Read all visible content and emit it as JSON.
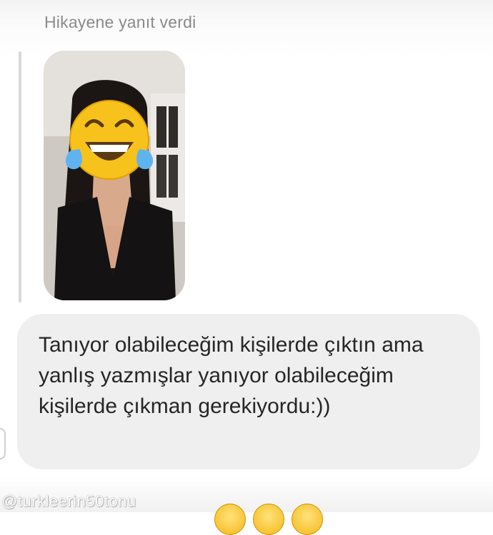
{
  "story_reply": {
    "header": "Hikayene yanıt verdi"
  },
  "story_preview": {
    "cover_emoji_icon": "tears-of-joy-emoji-icon"
  },
  "message": {
    "text": "Tanıyor olabileceğim kişilerde çıktın ama yanlış yazmışlar yanıyor olabileceğim kişilerde çıkman gerekiyordu:))"
  },
  "watermark": {
    "text": "@turkleerin50tonu"
  },
  "bottom_emojis": [
    "emoji-icon",
    "emoji-icon",
    "emoji-icon"
  ]
}
